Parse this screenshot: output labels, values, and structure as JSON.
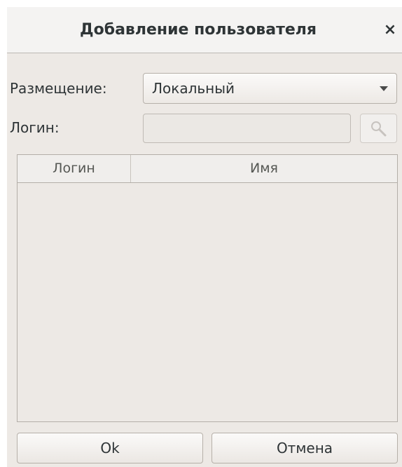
{
  "dialog": {
    "title": "Добавление пользователя",
    "close_symbol": "×"
  },
  "form": {
    "placement_label": "Размещение:",
    "placement_value": "Локальный",
    "login_label": "Логин:",
    "login_value": "",
    "search_icon": "search-icon"
  },
  "table": {
    "columns": [
      "Логин",
      "Имя"
    ],
    "rows": []
  },
  "buttons": {
    "ok_label": "Ok",
    "cancel_label": "Отмена"
  },
  "colors": {
    "background": "#ede9e5",
    "text": "#2e3436"
  }
}
